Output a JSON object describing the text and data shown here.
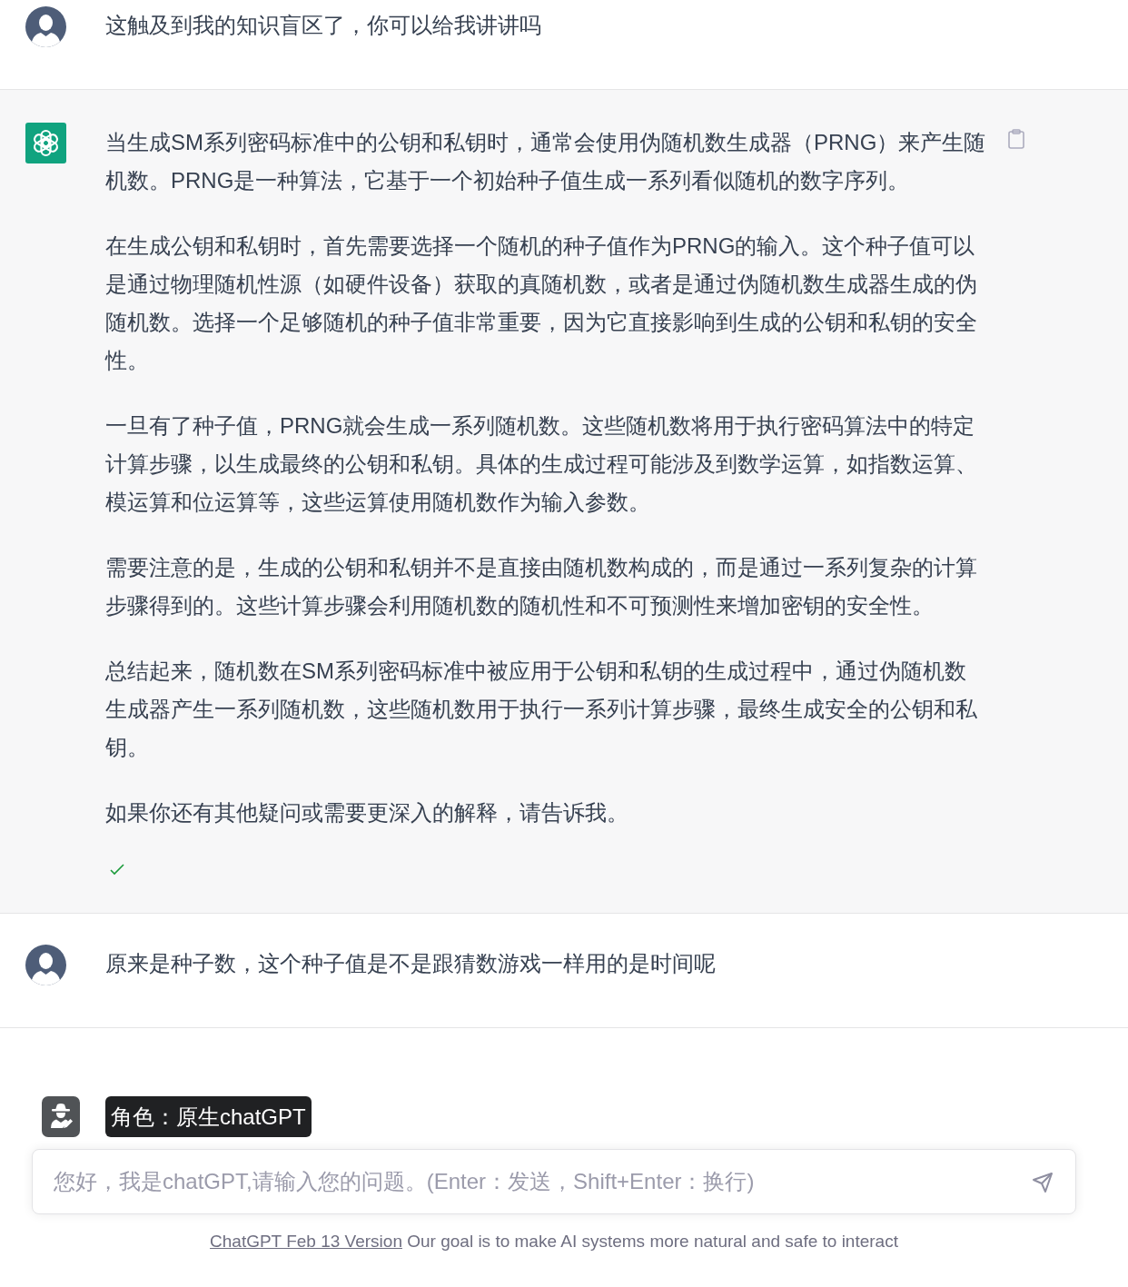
{
  "messages": [
    {
      "kind": "user",
      "text": "这触及到我的知识盲区了，你可以给我讲讲吗"
    },
    {
      "kind": "assistant",
      "paragraphs": [
        "当生成SM系列密码标准中的公钥和私钥时，通常会使用伪随机数生成器（PRNG）来产生随机数。PRNG是一种算法，它基于一个初始种子值生成一系列看似随机的数字序列。",
        "在生成公钥和私钥时，首先需要选择一个随机的种子值作为PRNG的输入。这个种子值可以是通过物理随机性源（如硬件设备）获取的真随机数，或者是通过伪随机数生成器生成的伪随机数。选择一个足够随机的种子值非常重要，因为它直接影响到生成的公钥和私钥的安全性。",
        "一旦有了种子值，PRNG就会生成一系列随机数。这些随机数将用于执行密码算法中的特定计算步骤，以生成最终的公钥和私钥。具体的生成过程可能涉及到数学运算，如指数运算、模运算和位运算等，这些运算使用随机数作为输入参数。",
        "需要注意的是，生成的公钥和私钥并不是直接由随机数构成的，而是通过一系列复杂的计算步骤得到的。这些计算步骤会利用随机数的随机性和不可预测性来增加密钥的安全性。",
        "总结起来，随机数在SM系列密码标准中被应用于公钥和私钥的生成过程中，通过伪随机数生成器产生一系列随机数，这些随机数用于执行一系列计算步骤，最终生成安全的公钥和私钥。",
        "如果你还有其他疑问或需要更深入的解释，请告诉我。"
      ],
      "finished": true
    },
    {
      "kind": "user",
      "text": "原来是种子数，这个种子值是不是跟猜数游戏一样用的是时间呢"
    }
  ],
  "role_badge": {
    "text": "角色：原生chatGPT"
  },
  "composer": {
    "placeholder": "您好，我是chatGPT,请输入您的问题。(Enter：发送，Shift+Enter：换行)"
  },
  "footer": {
    "link": "ChatGPT Feb 13 Version",
    "text": "Our goal is to make AI systems more natural and safe to interact"
  }
}
